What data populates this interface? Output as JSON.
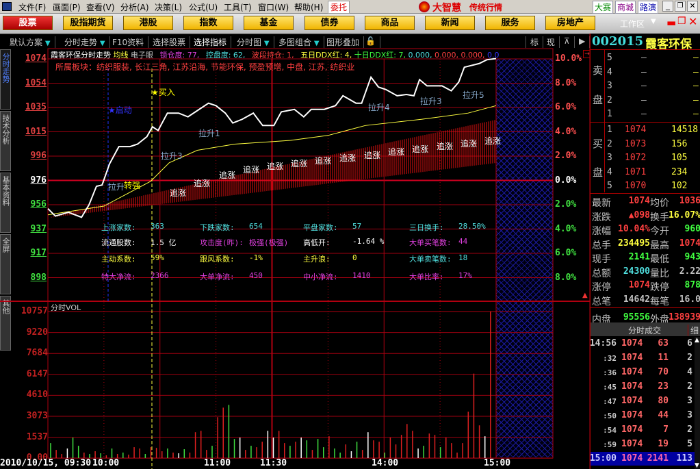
{
  "menu": {
    "items": [
      "文件(F)",
      "画面(P)",
      "查看(V)",
      "分析(A)",
      "决策(L)",
      "公式(U)",
      "工具(T)",
      "窗口(W)",
      "帮助(H)"
    ],
    "trade": "委托",
    "brand": "大智慧",
    "brand_sub": "传统行情",
    "right_links": [
      "大赛",
      "商城",
      "路演"
    ]
  },
  "categories": [
    "股票",
    "股指期货",
    "港股",
    "指数",
    "基金",
    "债券",
    "商品",
    "新闻",
    "服务",
    "房地产"
  ],
  "workspace": "工作区",
  "toolbar": {
    "items": [
      "默认方案",
      "分时走势",
      "F10资料",
      "选择股票",
      "选择指标",
      "分时图",
      "多图组合",
      "图形叠加"
    ],
    "right": [
      "标",
      "现"
    ]
  },
  "left_tabs": [
    "分时走势",
    "技术分析",
    "基本资料",
    "全屏",
    "其他"
  ],
  "chart_header": {
    "title": "霞客环保分时走势",
    "ma": "均线",
    "eye": "电子眼",
    "lock": "锁仓度: 77,",
    "control": "控盘度: 62,",
    "band": "波段持仓: 1,",
    "ddx5": "五日DDX红: 4,",
    "ddx10": "十日DDX红: 7,",
    "v1": "0.000,",
    "v2": "0.000,",
    "v3": "0.000,",
    "v4": "0.0"
  },
  "sector": "所属板块：纺织服装, 长江三角, 江苏沿海, 节能环保, 预盈预增, 中盘, 江苏, 纺织业",
  "stats": [
    [
      "上涨家数:",
      "363",
      "下跌家数:",
      "654",
      "平盘家数:",
      "57",
      "三日换手:",
      "28.50%"
    ],
    [
      "流通股数:",
      "1.5 亿",
      "攻击度(昨):",
      "极强(极强)",
      "高低开:",
      "-1.64 %",
      "大单买笔数:",
      "44"
    ],
    [
      "主动系数:",
      "59%",
      "跟风系数:",
      "-1%",
      "主升浪:",
      "0",
      "大单卖笔数:",
      "18"
    ],
    [
      "特大净流:",
      "2366",
      "大单净流:",
      "450",
      "中小净流:",
      "1410",
      "大单比率:",
      "17%"
    ]
  ],
  "signals": {
    "start": "启动",
    "buy": "买入",
    "chase": "追涨",
    "pulls": [
      "拉升1",
      "拉升3",
      "拉升",
      "转强",
      "拉升4",
      "拉升3",
      "拉升5"
    ]
  },
  "vol_title": "分时VOL",
  "time_axis": [
    "2010/10/15, 09:30",
    "10:00",
    "11:00",
    "11:30",
    "14:00",
    "15:00"
  ],
  "chart_data": {
    "type": "line",
    "prev_close": 976,
    "price_ticks": [
      "1074",
      "1054",
      "1035",
      "1015",
      "996",
      "976",
      "956",
      "937",
      "917",
      "898"
    ],
    "pct_ticks": [
      "10.0%",
      "8.0%",
      "6.0%",
      "4.0%",
      "2.0%",
      "0.0%",
      "2.0%",
      "4.0%",
      "6.0%",
      "8.0%"
    ],
    "vol_ticks": [
      "10757",
      "9220",
      "7684",
      "6147",
      "4610",
      "3073",
      "1537",
      "0.00"
    ],
    "ylim": [
      898,
      1074
    ],
    "vol_max": 10757,
    "minutes_total": 240,
    "price": [
      [
        0,
        953
      ],
      [
        4,
        947
      ],
      [
        11,
        950
      ],
      [
        18,
        946
      ],
      [
        22,
        956
      ],
      [
        26,
        971
      ],
      [
        29,
        972
      ],
      [
        33,
        989
      ],
      [
        38,
        1003
      ],
      [
        44,
        1003
      ],
      [
        48,
        1005
      ],
      [
        53,
        1011
      ],
      [
        56,
        1019
      ],
      [
        59,
        1016
      ],
      [
        64,
        1030
      ],
      [
        70,
        1030
      ],
      [
        75,
        1027
      ],
      [
        81,
        1033
      ],
      [
        86,
        1038
      ],
      [
        90,
        1036
      ],
      [
        95,
        1030
      ],
      [
        99,
        1022
      ],
      [
        104,
        1025
      ],
      [
        110,
        1030
      ],
      [
        115,
        1020
      ],
      [
        121,
        1020
      ],
      [
        125,
        1031
      ],
      [
        132,
        1033
      ],
      [
        137,
        1027
      ],
      [
        141,
        1033
      ],
      [
        148,
        1033
      ],
      [
        154,
        1036
      ],
      [
        158,
        1044
      ],
      [
        165,
        1038
      ],
      [
        168,
        1038
      ],
      [
        173,
        1059
      ],
      [
        177,
        1051
      ],
      [
        181,
        1049
      ],
      [
        187,
        1044
      ],
      [
        192,
        1045
      ],
      [
        196,
        1044
      ],
      [
        199,
        1057
      ],
      [
        203,
        1052
      ],
      [
        211,
        1052
      ],
      [
        216,
        1048
      ],
      [
        220,
        1055
      ],
      [
        223,
        1067
      ],
      [
        231,
        1070
      ],
      [
        235,
        1073
      ],
      [
        240,
        1074
      ]
    ],
    "avg": [
      [
        0,
        948
      ],
      [
        30,
        955
      ],
      [
        55,
        975
      ],
      [
        65,
        990
      ],
      [
        80,
        1000
      ],
      [
        100,
        1005
      ],
      [
        130,
        1008
      ],
      [
        150,
        1012
      ],
      [
        170,
        1020
      ],
      [
        200,
        1025
      ],
      [
        225,
        1030
      ],
      [
        240,
        1036
      ]
    ],
    "volume": [
      1100,
      600,
      300,
      700,
      1500,
      900,
      400,
      300,
      500,
      350,
      200,
      700,
      300,
      400,
      250,
      800,
      700,
      300,
      800,
      750,
      500,
      700,
      400,
      350,
      650,
      400,
      1900,
      2000,
      600,
      900,
      3000,
      3700,
      3900,
      1400,
      1500,
      600,
      900,
      800,
      1200,
      2000,
      1500,
      2000,
      1100,
      900,
      1200,
      1500,
      1300,
      600,
      1400,
      800,
      1600,
      700,
      400,
      1000,
      500,
      1200,
      600,
      1900,
      1300,
      1200,
      400,
      1500,
      1000,
      1700,
      2500,
      2000,
      700,
      900,
      1800,
      1700,
      800,
      1500,
      1100,
      400,
      1100,
      3400,
      6200,
      2400,
      1600,
      10757
    ],
    "volume_dir": "grrwggrgrgrgrgrrrgrrrgrwgrrrrgrrggwrgrrwwrrgrwgrggrggrwgrwrrgrrrrrwgrrgrrrrrrrwr"
  },
  "quote": {
    "code": "002015",
    "name": "霞客环保",
    "sell": [
      [
        "5",
        "—",
        "—"
      ],
      [
        "4",
        "—",
        "—"
      ],
      [
        "3",
        "—",
        "—"
      ],
      [
        "2",
        "—",
        "—"
      ],
      [
        "1",
        "—",
        "—"
      ]
    ],
    "sell_label": [
      "卖",
      "盘"
    ],
    "buy_label": [
      "买",
      "盘"
    ],
    "buy": [
      [
        "1",
        "1074",
        "14518"
      ],
      [
        "2",
        "1073",
        "156"
      ],
      [
        "3",
        "1072",
        "105"
      ],
      [
        "4",
        "1071",
        "234"
      ],
      [
        "5",
        "1070",
        "102"
      ]
    ],
    "fields": [
      [
        "最新",
        "1074",
        "均价",
        "1036"
      ],
      [
        "涨跌",
        "▲098",
        "换手",
        "16.07%"
      ],
      [
        "涨幅",
        "10.04%",
        "今开",
        "960"
      ],
      [
        "总手",
        "234495",
        "最高",
        "1074"
      ],
      [
        "现手",
        "2141",
        "最低",
        "943"
      ],
      [
        "总额",
        "24300",
        "量比",
        "2.22"
      ],
      [
        "涨停",
        "1074",
        "跌停",
        "878"
      ],
      [
        "总笔",
        "14642",
        "每笔",
        "16.0"
      ],
      [
        "内盘",
        "95556",
        "外盘",
        "138939"
      ]
    ],
    "ticks_title": "分时成交",
    "ticks_detail": "细",
    "ticks": [
      [
        "14:56",
        "1074",
        "63",
        "6"
      ],
      [
        ":32",
        "1074",
        "11",
        "2"
      ],
      [
        ":36",
        "1074",
        "70",
        "4"
      ],
      [
        ":45",
        "1074",
        "23",
        "2"
      ],
      [
        ":47",
        "1074",
        "80",
        "3"
      ],
      [
        ":50",
        "1074",
        "44",
        "3"
      ],
      [
        ":54",
        "1074",
        "7",
        "2"
      ],
      [
        ":59",
        "1074",
        "19",
        "5"
      ],
      [
        "15:00",
        "1074",
        "2141",
        "113"
      ]
    ]
  }
}
